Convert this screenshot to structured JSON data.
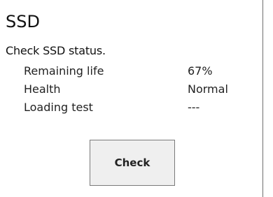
{
  "panel": {
    "title": "SSD",
    "description": "Check SSD status.",
    "rows": [
      {
        "label": "Remaining life",
        "value": "67%"
      },
      {
        "label": "Health",
        "value": "Normal"
      },
      {
        "label": "Loading test",
        "value": "---"
      }
    ],
    "check_label": "Check"
  }
}
